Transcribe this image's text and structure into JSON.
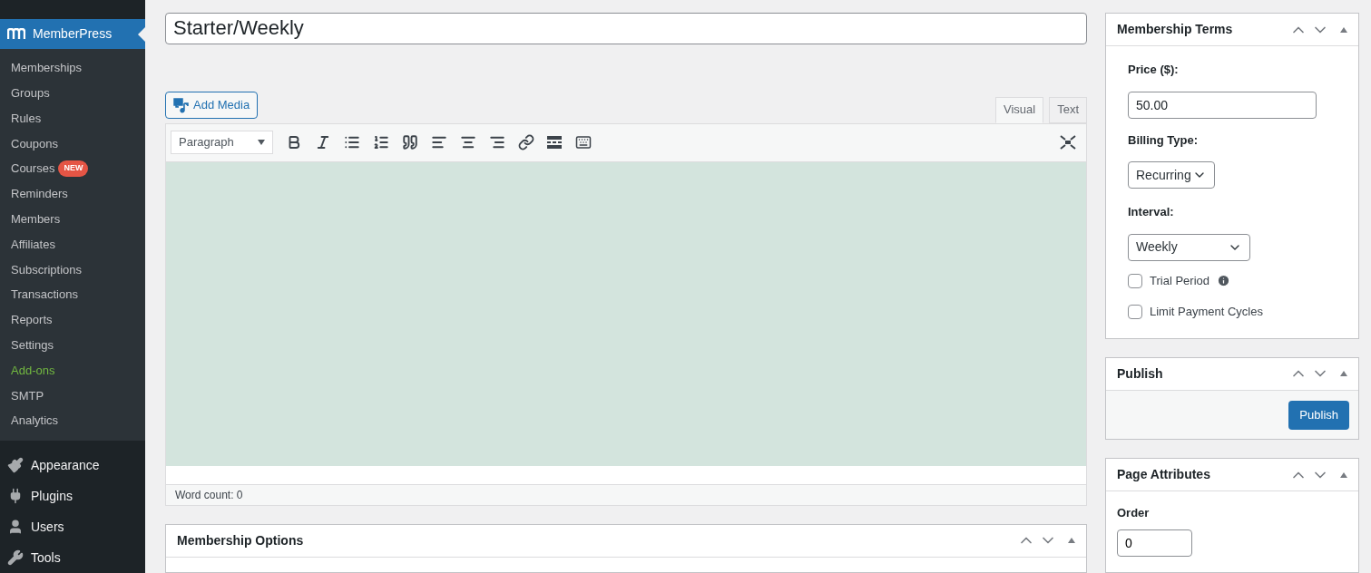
{
  "sidebar": {
    "plugin": {
      "label": "MemberPress",
      "selected": true
    },
    "submenu": [
      {
        "label": "Memberships",
        "highlighted": false
      },
      {
        "label": "Groups",
        "highlighted": false
      },
      {
        "label": "Rules",
        "highlighted": false
      },
      {
        "label": "Coupons",
        "highlighted": false
      },
      {
        "label": "Courses",
        "highlighted": false,
        "badge": "NEW"
      },
      {
        "label": "Reminders",
        "highlighted": false
      },
      {
        "label": "Members",
        "highlighted": false
      },
      {
        "label": "Affiliates",
        "highlighted": false
      },
      {
        "label": "Subscriptions",
        "highlighted": false
      },
      {
        "label": "Transactions",
        "highlighted": false
      },
      {
        "label": "Reports",
        "highlighted": false
      },
      {
        "label": "Settings",
        "highlighted": false
      },
      {
        "label": "Add-ons",
        "highlighted": true
      },
      {
        "label": "SMTP",
        "highlighted": false
      },
      {
        "label": "Analytics",
        "highlighted": false
      }
    ],
    "menu": [
      {
        "label": "Appearance",
        "kind": "brush"
      },
      {
        "label": "Plugins",
        "kind": "plug"
      },
      {
        "label": "Users",
        "kind": "user"
      },
      {
        "label": "Tools",
        "kind": "wrench"
      }
    ]
  },
  "title": {
    "value": "Starter/Weekly"
  },
  "add_media": "Add Media",
  "editor_tabs": [
    {
      "label": "Visual",
      "selected": true
    },
    {
      "label": "Text",
      "selected": false
    }
  ],
  "format_select": "Paragraph",
  "word_count": "Word count: 0",
  "membership_options": {
    "title": "Membership Options"
  },
  "membership_terms": {
    "title": "Membership Terms",
    "price_label": "Price ($):",
    "price": "50.00",
    "billing_label": "Billing Type:",
    "billing": "Recurring",
    "interval_label": "Interval:",
    "interval": "Weekly",
    "options": [
      {
        "label": "Trial Period",
        "checked": false,
        "info": true
      },
      {
        "label": "Limit Payment Cycles",
        "checked": false,
        "info": false
      }
    ]
  },
  "publish": {
    "title": "Publish",
    "button": "Publish"
  },
  "page_attributes": {
    "title": "Page Attributes",
    "order_label": "Order",
    "order": "0"
  }
}
